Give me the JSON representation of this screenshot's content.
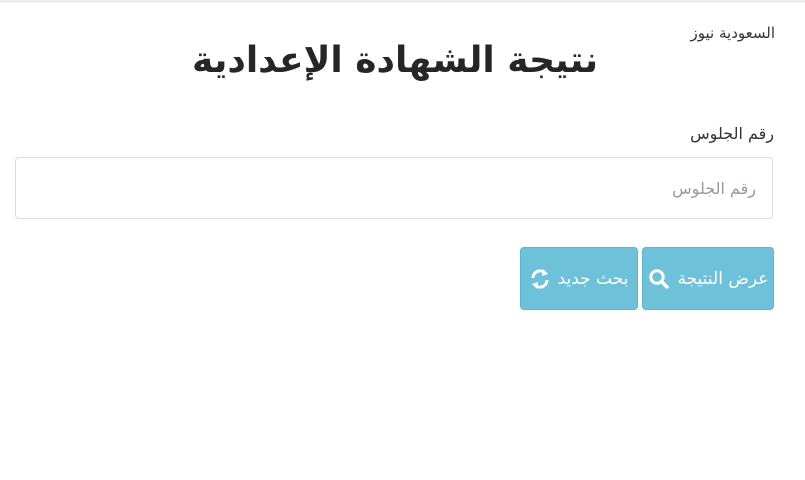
{
  "watermark": "السعودية نيوز",
  "page": {
    "title": "نتيجة الشهادة الإعدادية"
  },
  "form": {
    "seat_label": "رقم الجلوس",
    "seat_placeholder": "رقم الجلوس",
    "seat_value": ""
  },
  "buttons": {
    "show_result": {
      "label": "عرض النتيجة",
      "icon": "search-icon"
    },
    "new_search": {
      "label": "بحث جديد",
      "icon": "refresh-icon"
    }
  },
  "colors": {
    "button_bg": "#6dc1d9",
    "button_border": "#5fb5cf",
    "button_text": "#ffffff",
    "title_text": "#262626",
    "input_border": "#dcdcdc",
    "placeholder": "#9a9a9a"
  }
}
